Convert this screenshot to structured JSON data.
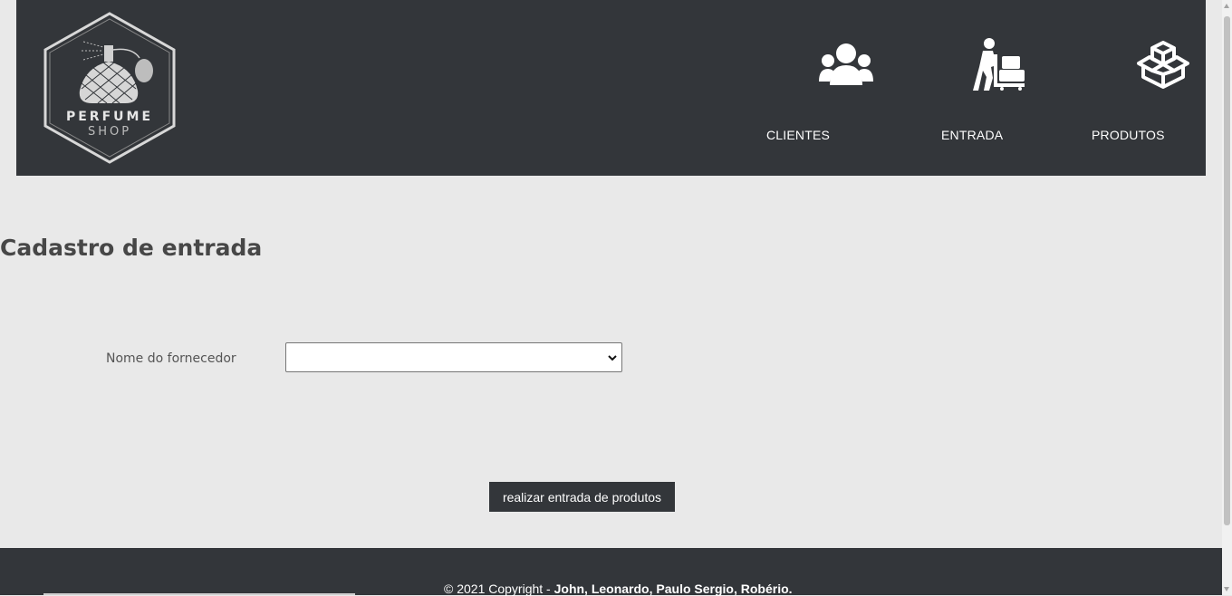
{
  "brand": {
    "line1": "PERFUME",
    "line2": "SHOP"
  },
  "nav": {
    "clients_label": "CLIENTES",
    "clients_icon": "users-icon",
    "entry_label": "ENTRADA",
    "entry_icon": "dolly-worker-icon",
    "products_label": "PRODUTOS",
    "products_icon": "boxes-icon"
  },
  "main": {
    "title": "Cadastro de entrada",
    "supplier_label": "Nome do fornecedor",
    "supplier_value": "",
    "submit_label": "realizar entrada de produtos"
  },
  "footer": {
    "prefix": "© 2021 Copyright - ",
    "authors": "John, Leonardo, Paulo Sergio, Robério."
  },
  "colors": {
    "header_bg": "#33363a",
    "page_bg": "#e9e9e9",
    "footer_bg": "#33363a"
  }
}
